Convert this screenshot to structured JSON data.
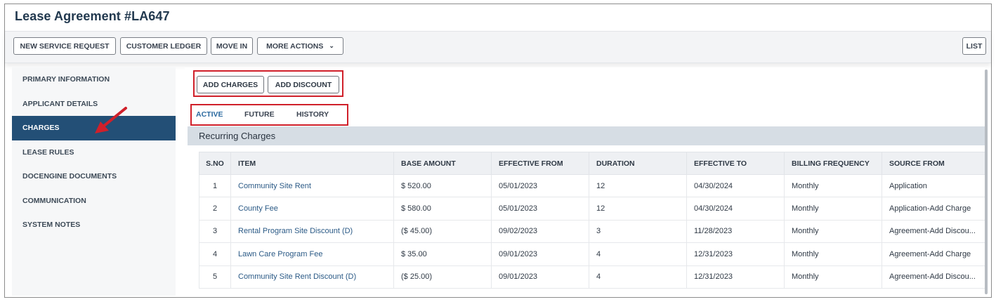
{
  "header": {
    "title": "Lease Agreement #LA647"
  },
  "toolbar": {
    "new_service_request": "NEW SERVICE REQUEST",
    "customer_ledger": "CUSTOMER LEDGER",
    "move_in": "MOVE IN",
    "more_actions": "MORE ACTIONS",
    "more_actions_icon": "chevron-down-icon",
    "list": "LIST"
  },
  "sidebar": {
    "items": [
      {
        "label": "PRIMARY INFORMATION"
      },
      {
        "label": "APPLICANT DETAILS"
      },
      {
        "label": "CHARGES",
        "active": true
      },
      {
        "label": "LEASE RULES"
      },
      {
        "label": "DOCENGINE DOCUMENTS"
      },
      {
        "label": "COMMUNICATION"
      },
      {
        "label": "SYSTEM NOTES"
      }
    ]
  },
  "annotation": {
    "arrow_color": "#d0202a",
    "highlight_color": "#d0202a"
  },
  "actions": {
    "add_charges": "ADD CHARGES",
    "add_discount": "ADD DISCOUNT"
  },
  "tabs": [
    {
      "label": "ACTIVE",
      "active": true
    },
    {
      "label": "FUTURE"
    },
    {
      "label": "HISTORY"
    }
  ],
  "section": {
    "title": "Recurring Charges"
  },
  "table": {
    "columns": [
      "S.NO",
      "ITEM",
      "BASE AMOUNT",
      "EFFECTIVE FROM",
      "DURATION",
      "EFFECTIVE TO",
      "BILLING FREQUENCY",
      "SOURCE FROM"
    ],
    "rows": [
      [
        "1",
        "Community Site Rent",
        "$ 520.00",
        "05/01/2023",
        "12",
        "04/30/2024",
        "Monthly",
        "Application"
      ],
      [
        "2",
        "County Fee",
        "$ 580.00",
        "05/01/2023",
        "12",
        "04/30/2024",
        "Monthly",
        "Application-Add Charge"
      ],
      [
        "3",
        "Rental Program Site Discount (D)",
        "($ 45.00)",
        "09/02/2023",
        "3",
        "11/28/2023",
        "Monthly",
        "Agreement-Add Discou..."
      ],
      [
        "4",
        "Lawn Care Program Fee",
        "$ 35.00",
        "09/01/2023",
        "4",
        "12/31/2023",
        "Monthly",
        "Agreement-Add Charge"
      ],
      [
        "5",
        "Community Site Rent Discount (D)",
        "($ 25.00)",
        "09/01/2023",
        "4",
        "12/31/2023",
        "Monthly",
        "Agreement-Add Discou..."
      ]
    ]
  },
  "colors": {
    "title": "#22394f",
    "sidebar_active_bg": "#234f76",
    "link": "#2b5a86",
    "section_header_bg": "#d6dde4"
  }
}
